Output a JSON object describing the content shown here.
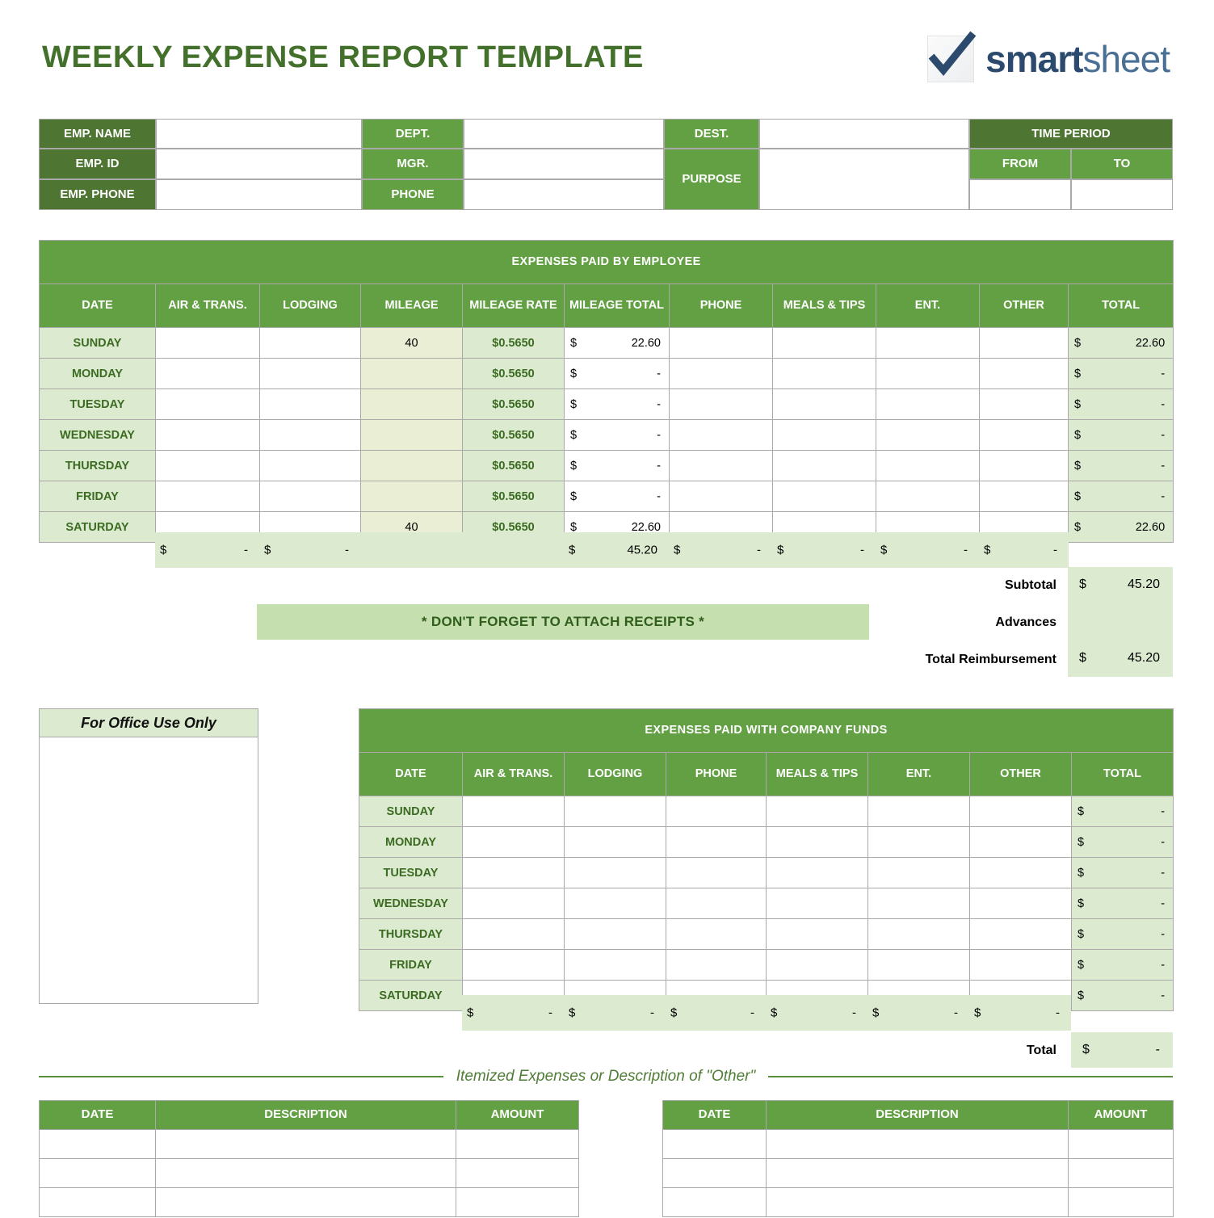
{
  "document": {
    "title": "WEEKLY EXPENSE REPORT TEMPLATE",
    "brand": {
      "bold": "smart",
      "light": "sheet",
      "logo_icon": "checkmark-page-icon"
    }
  },
  "colors": {
    "dark_green": "#4e7532",
    "medium_green": "#63a044",
    "light_green": "#dcebd0",
    "pale_green": "#e8f0de",
    "mileage_tint": "#eaeed5",
    "banner_green": "#c6dfae",
    "title_green": "#43702a",
    "day_text_green": "#3c6b22",
    "border_gray": "#a9a9a9",
    "logo_blue_dark": "#2c4a6e",
    "logo_blue_light": "#4a6f94"
  },
  "info_form": {
    "emp_name_label": "EMP. NAME",
    "emp_id_label": "EMP. ID",
    "emp_phone_label": "EMP. PHONE",
    "dept_label": "DEPT.",
    "mgr_label": "MGR.",
    "phone_label": "PHONE",
    "dest_label": "DEST.",
    "purpose_label": "PURPOSE",
    "time_period_label": "TIME PERIOD",
    "from_label": "FROM",
    "to_label": "TO",
    "emp_name_value": "",
    "emp_id_value": "",
    "emp_phone_value": "",
    "dept_value": "",
    "mgr_value": "",
    "phone_value": "",
    "dest_value": "",
    "purpose_value": "",
    "from_value": "",
    "to_value": ""
  },
  "employee_table": {
    "banner": "EXPENSES PAID BY EMPLOYEE",
    "columns": [
      "DATE",
      "AIR & TRANS.",
      "LODGING",
      "MILEAGE",
      "MILEAGE RATE",
      "MILEAGE TOTAL",
      "PHONE",
      "MEALS & TIPS",
      "ENT.",
      "OTHER",
      "TOTAL"
    ],
    "rows": [
      {
        "day": "SUNDAY",
        "air": "",
        "lodging": "",
        "mileage": "40",
        "rate": "$0.5650",
        "mileage_total_sym": "$",
        "mileage_total_val": "22.60",
        "phone": "",
        "meals": "",
        "ent": "",
        "other": "",
        "total_sym": "$",
        "total_val": "22.60"
      },
      {
        "day": "MONDAY",
        "air": "",
        "lodging": "",
        "mileage": "",
        "rate": "$0.5650",
        "mileage_total_sym": "$",
        "mileage_total_val": "-",
        "phone": "",
        "meals": "",
        "ent": "",
        "other": "",
        "total_sym": "$",
        "total_val": "-"
      },
      {
        "day": "TUESDAY",
        "air": "",
        "lodging": "",
        "mileage": "",
        "rate": "$0.5650",
        "mileage_total_sym": "$",
        "mileage_total_val": "-",
        "phone": "",
        "meals": "",
        "ent": "",
        "other": "",
        "total_sym": "$",
        "total_val": "-"
      },
      {
        "day": "WEDNESDAY",
        "air": "",
        "lodging": "",
        "mileage": "",
        "rate": "$0.5650",
        "mileage_total_sym": "$",
        "mileage_total_val": "-",
        "phone": "",
        "meals": "",
        "ent": "",
        "other": "",
        "total_sym": "$",
        "total_val": "-"
      },
      {
        "day": "THURSDAY",
        "air": "",
        "lodging": "",
        "mileage": "",
        "rate": "$0.5650",
        "mileage_total_sym": "$",
        "mileage_total_val": "-",
        "phone": "",
        "meals": "",
        "ent": "",
        "other": "",
        "total_sym": "$",
        "total_val": "-"
      },
      {
        "day": "FRIDAY",
        "air": "",
        "lodging": "",
        "mileage": "",
        "rate": "$0.5650",
        "mileage_total_sym": "$",
        "mileage_total_val": "-",
        "phone": "",
        "meals": "",
        "ent": "",
        "other": "",
        "total_sym": "$",
        "total_val": "-"
      },
      {
        "day": "SATURDAY",
        "air": "",
        "lodging": "",
        "mileage": "40",
        "rate": "$0.5650",
        "mileage_total_sym": "$",
        "mileage_total_val": "22.60",
        "phone": "",
        "meals": "",
        "ent": "",
        "other": "",
        "total_sym": "$",
        "total_val": "22.60"
      }
    ],
    "sums": {
      "air_sym": "$",
      "air_val": "-",
      "lodging_sym": "$",
      "lodging_val": "-",
      "mileage_total_sym": "$",
      "mileage_total_val": "45.20",
      "phone_sym": "$",
      "phone_val": "-",
      "meals_sym": "$",
      "meals_val": "-",
      "ent_sym": "$",
      "ent_val": "-",
      "other_sym": "$",
      "other_val": "-"
    },
    "summary": {
      "subtotal_label": "Subtotal",
      "subtotal_sym": "$",
      "subtotal_val": "45.20",
      "advances_label": "Advances",
      "advances_sym": "",
      "advances_val": "",
      "reimbursement_label": "Total Reimbursement",
      "reimbursement_sym": "$",
      "reimbursement_val": "45.20"
    },
    "receipts_note": "* DON'T FORGET TO ATTACH RECEIPTS *"
  },
  "office_use": {
    "title": "For Office Use Only",
    "content": ""
  },
  "company_table": {
    "banner": "EXPENSES PAID WITH COMPANY FUNDS",
    "columns": [
      "DATE",
      "AIR & TRANS.",
      "LODGING",
      "PHONE",
      "MEALS & TIPS",
      "ENT.",
      "OTHER",
      "TOTAL"
    ],
    "rows": [
      {
        "day": "SUNDAY",
        "total_sym": "$",
        "total_val": "-"
      },
      {
        "day": "MONDAY",
        "total_sym": "$",
        "total_val": "-"
      },
      {
        "day": "TUESDAY",
        "total_sym": "$",
        "total_val": "-"
      },
      {
        "day": "WEDNESDAY",
        "total_sym": "$",
        "total_val": "-"
      },
      {
        "day": "THURSDAY",
        "total_sym": "$",
        "total_val": "-"
      },
      {
        "day": "FRIDAY",
        "total_sym": "$",
        "total_val": "-"
      },
      {
        "day": "SATURDAY",
        "total_sym": "$",
        "total_val": "-"
      }
    ],
    "sums": {
      "air_sym": "$",
      "air_val": "-",
      "lodging_sym": "$",
      "lodging_val": "-",
      "phone_sym": "$",
      "phone_val": "-",
      "meals_sym": "$",
      "meals_val": "-",
      "ent_sym": "$",
      "ent_val": "-",
      "other_sym": "$",
      "other_val": "-"
    },
    "total_label": "Total",
    "total_sym": "$",
    "total_val": "-"
  },
  "itemized": {
    "divider_label": "Itemized Expenses or Description of \"Other\"",
    "columns": [
      "DATE",
      "DESCRIPTION",
      "AMOUNT"
    ],
    "row_count": 3
  }
}
